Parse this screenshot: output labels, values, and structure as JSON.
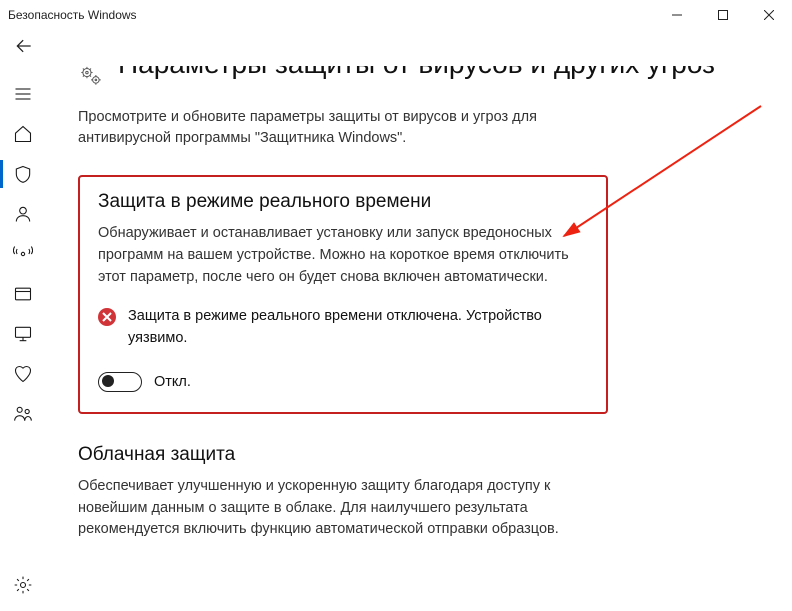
{
  "window": {
    "title": "Безопасность Windows"
  },
  "page": {
    "title": "Параметры защиты от вирусов и других угроз",
    "subtitle": "Просмотрите и обновите параметры защиты от вирусов и угроз для антивирусной программы \"Защитника Windows\"."
  },
  "sections": {
    "realtime": {
      "title": "Защита в режиме реального времени",
      "text": "Обнаруживает и останавливает установку или запуск вредоносных программ на вашем устройстве. Можно на короткое время отключить этот параметр, после чего он будет снова включен автоматически.",
      "alert": "Защита в режиме реального времени отключена. Устройство уязвимо.",
      "toggle_state": "Откл."
    },
    "cloud": {
      "title": "Облачная защита",
      "text": "Обеспечивает улучшенную и ускоренную защиту благодаря доступу к новейшим данным о защите в облаке. Для наилучшего результата рекомендуется включить функцию автоматической отправки образцов."
    }
  },
  "sidebar": {
    "items": [
      {
        "name": "menu-icon"
      },
      {
        "name": "home-icon"
      },
      {
        "name": "shield-icon"
      },
      {
        "name": "person-icon"
      },
      {
        "name": "network-icon"
      },
      {
        "name": "app-browser-icon"
      },
      {
        "name": "device-icon"
      },
      {
        "name": "heart-icon"
      },
      {
        "name": "family-icon"
      }
    ]
  }
}
